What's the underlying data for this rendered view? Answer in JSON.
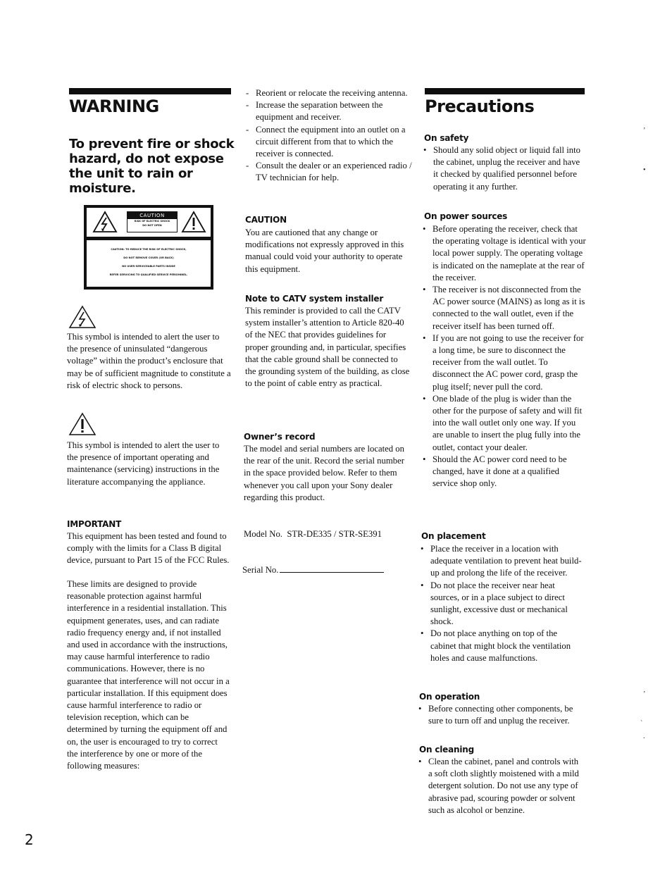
{
  "page_number": "2",
  "warning": {
    "title": "WARNING",
    "hazard_text": "To prevent fire or shock hazard, do not expose the unit to rain or moisture.",
    "label": {
      "header": "CAUTION",
      "sub_lines": [
        "RISK OF ELECTRIC SHOCK",
        "DO NOT OPEN"
      ],
      "lines": [
        "CAUTION: TO REDUCE THE RISK OF ELECTRIC SHOCK,",
        "DO NOT REMOVE COVER (OR BACK)",
        "NO USER-SERVICEABLE PARTS INSIDE",
        "REFER SERVICING TO QUALIFIED SERVICE PERSONNEL."
      ]
    },
    "lightning_symbol_text": "This symbol is intended to alert the user to the presence of uninsulated “dangerous voltage” within the product’s enclosure that may be of sufficient magnitude to constitute a risk of electric shock to persons.",
    "exclamation_symbol_text": "This symbol is intended to alert the user to the presence of important operating and maintenance (servicing) instructions in the literature accompanying the appliance.",
    "important": {
      "heading": "IMPORTANT",
      "paragraph1": "This equipment has been tested and found to comply with the limits for a Class B digital device, pursuant to Part 15 of the FCC Rules.",
      "paragraph2": "These limits are designed to provide reasonable protection against harmful interference in a residential installation. This equipment generates, uses, and can radiate radio frequency energy and, if not installed and used in accordance with the instructions, may cause harmful interference to radio communications. However, there is no guarantee that interference will not occur in a particular installation. If this equipment does cause harmful interference to radio or television reception, which can be determined by turning the equipment off and on, the user is encouraged to try to correct the interference by one or more of the following measures:"
    }
  },
  "measures": [
    "Reorient or relocate the receiving antenna.",
    "Increase the separation between the equipment and receiver.",
    "Connect the equipment into an outlet on a circuit different from that to which the receiver is connected.",
    "Consult the dealer or an experienced radio / TV technician for help."
  ],
  "caution": {
    "heading": "CAUTION",
    "text": "You are cautioned that any change or modifications not expressly approved in this manual could void your authority to operate this equipment."
  },
  "catv": {
    "heading": "Note to CATV system installer",
    "text": "This reminder is provided to call the CATV system installer’s attention to Article 820-40 of the NEC that provides guidelines for proper grounding and, in particular, specifies that the cable ground shall be connected to the grounding system of the building, as close to the point of cable entry as practical."
  },
  "owners_record": {
    "heading": "Owner’s record",
    "text": "The model and serial numbers are located on the rear of the unit. Record the serial number in the space provided below. Refer to them whenever you call upon your Sony dealer regarding this product.",
    "model_label": "Model No.",
    "model_value": "STR-DE335 / STR-SE391",
    "serial_label": "Serial No.",
    "serial_value": ""
  },
  "precautions": {
    "title": "Precautions",
    "sections": [
      {
        "heading": "On safety",
        "items": [
          "Should any solid object or liquid fall into the cabinet, unplug the receiver and have it checked by qualified personnel before operating it any further."
        ]
      },
      {
        "heading": "On power sources",
        "items": [
          "Before operating the receiver, check that the operating voltage is identical with your local power supply. The operating voltage is indicated on the nameplate at the rear of the receiver.",
          "The receiver is not disconnected from the AC power source (MAINS) as long as it is connected to the wall outlet, even if the receiver itself has been turned off.",
          "If you are not going to use the receiver for a long time, be sure to disconnect the receiver from the wall outlet. To disconnect the AC power cord, grasp the plug itself;  never pull the cord.",
          "One blade of the plug is wider than the other for the purpose of safety and will fit into the wall outlet only one way. If you are unable to insert the plug fully into the outlet, contact your dealer.",
          "Should the AC power cord need to be changed, have it done at a qualified service shop only."
        ]
      },
      {
        "heading": "On placement",
        "items": [
          "Place the receiver in a location with adequate ventilation to prevent heat build-up and prolong the life of the receiver.",
          "Do not place the receiver near heat sources, or in a place subject to direct sunlight, excessive dust or mechanical shock.",
          "Do not place anything on top of the cabinet that might block the ventilation holes and cause malfunctions."
        ]
      },
      {
        "heading": "On operation",
        "items": [
          "Before connecting other components, be sure to turn off and unplug the receiver."
        ]
      },
      {
        "heading": "On cleaning",
        "items": [
          "Clean the cabinet, panel and controls with a soft cloth slightly moistened with a mild detergent solution. Do not use any type of abrasive pad, scouring powder or solvent such as alcohol or benzine."
        ]
      }
    ]
  }
}
